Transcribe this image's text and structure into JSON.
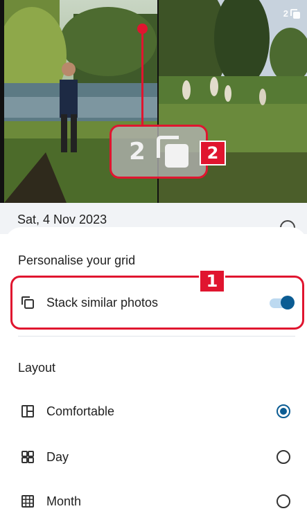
{
  "photo_grid": {
    "stack_count": "2",
    "zoom_stack_count": "2"
  },
  "annotations": {
    "badge_1": "1",
    "badge_2": "2",
    "accent_color": "#e0152f"
  },
  "date_header": {
    "date": "Sat, 4 Nov 2023"
  },
  "sheet": {
    "title": "Personalise your grid",
    "stack_option": {
      "icon": "stack-icon",
      "label": "Stack similar photos",
      "enabled": true
    },
    "layout_section": {
      "title": "Layout",
      "options": [
        {
          "label": "Comfortable",
          "icon": "comfortable-grid-icon",
          "selected": true
        },
        {
          "label": "Day",
          "icon": "day-grid-icon",
          "selected": false
        },
        {
          "label": "Month",
          "icon": "month-grid-icon",
          "selected": false
        }
      ]
    },
    "accent_color": "#0b5c93"
  }
}
